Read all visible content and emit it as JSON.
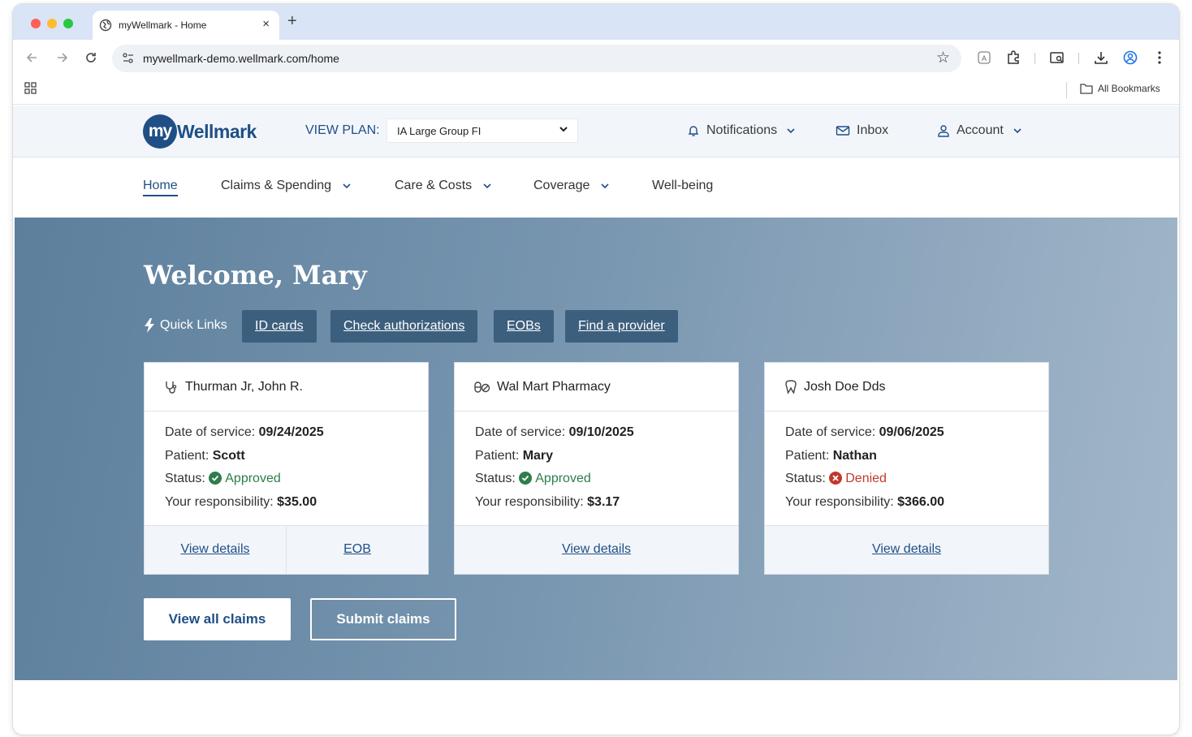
{
  "browser": {
    "tab_title": "myWellmark - Home",
    "tab_close": "×",
    "new_tab": "+",
    "url": "mywellmark-demo.wellmark.com/home",
    "bookmarks_label": "All Bookmarks",
    "icons": [
      "back-icon",
      "forward-icon",
      "reload-icon",
      "site-settings-icon",
      "star-icon",
      "translate-icon",
      "extensions-icon",
      "tab-search-icon",
      "download-icon",
      "profile-icon",
      "more-icon",
      "apps-icon",
      "folder-icon"
    ]
  },
  "header": {
    "logo_circle": "my",
    "logo_text": "Wellmark",
    "view_plan_label": "VIEW PLAN:",
    "plan_value": "IA Large Group FI",
    "notifications": "Notifications",
    "inbox": "Inbox",
    "account": "Account"
  },
  "nav": {
    "items": [
      "Home",
      "Claims & Spending",
      "Care & Costs",
      "Coverage",
      "Well-being"
    ]
  },
  "hero": {
    "welcome": "Welcome, Mary",
    "quick_links_label": "Quick Links",
    "quick_links": [
      "ID cards",
      "Check authorizations",
      "EOBs",
      "Find a provider"
    ]
  },
  "labels": {
    "date_of_service": "Date of service: ",
    "patient": "Patient: ",
    "status": "Status: ",
    "responsibility": "Your responsibility: "
  },
  "claims": [
    {
      "provider": "Thurman Jr, John R.",
      "icon": "stethoscope-icon",
      "date": "09/24/2025",
      "patient": "Scott",
      "status": "Approved",
      "responsibility": "$35.00",
      "links": [
        "View details",
        "EOB"
      ]
    },
    {
      "provider": "Wal Mart Pharmacy",
      "icon": "pills-icon",
      "date": "09/10/2025",
      "patient": "Mary",
      "status": "Approved",
      "responsibility": "$3.17",
      "links": [
        "View details"
      ]
    },
    {
      "provider": "Josh Doe Dds",
      "icon": "tooth-icon",
      "date": "09/06/2025",
      "patient": "Nathan",
      "status": "Denied",
      "responsibility": "$366.00",
      "links": [
        "View details"
      ]
    }
  ],
  "actions": {
    "view_all": "View all claims",
    "submit": "Submit claims"
  },
  "colors": {
    "brand": "#1f4f85",
    "approved": "#2e7d4a",
    "denied": "#c0392b",
    "quick_link_bg": "#3d5f7e"
  }
}
